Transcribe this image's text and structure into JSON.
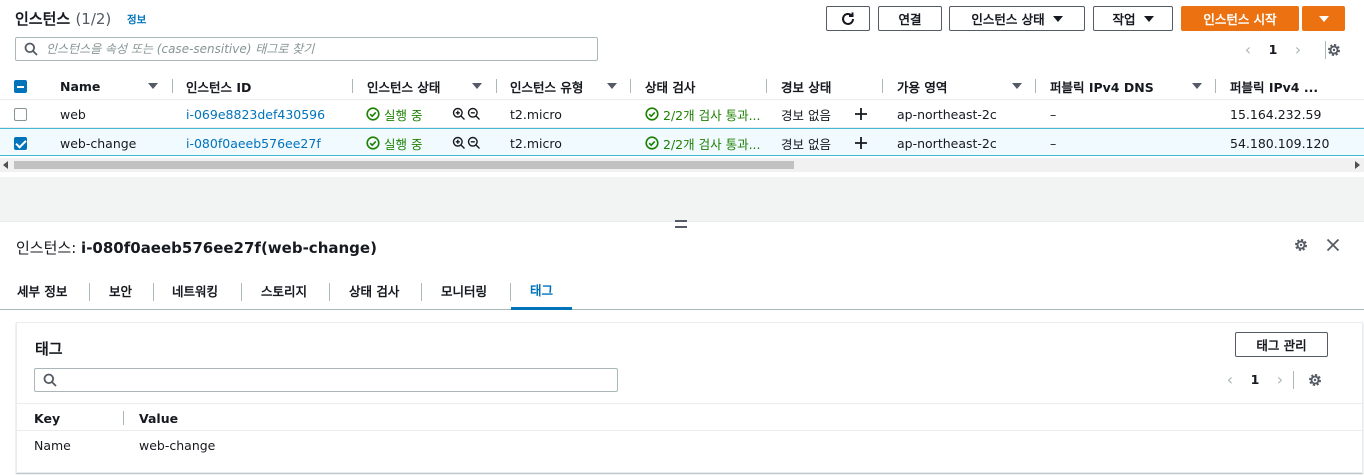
{
  "header": {
    "title": "인스턴스",
    "count": "(1/2)",
    "info_link": "정보"
  },
  "toolbar": {
    "connect": "연결",
    "instance_state": "인스턴스 상태",
    "actions": "작업",
    "launch": "인스턴스 시작"
  },
  "search": {
    "placeholder": "인스턴스을 속성 또는 (case-sensitive) 태그로 찾기"
  },
  "pagination": {
    "page": "1"
  },
  "table": {
    "columns": [
      "Name",
      "인스턴스 ID",
      "인스턴스 상태",
      "인스턴스 유형",
      "상태 검사",
      "경보 상태",
      "가용 영역",
      "퍼블릭 IPv4 DNS",
      "퍼블릭 IPv4 ..."
    ],
    "rows": [
      {
        "name": "web",
        "id": "i-069e8823def430596",
        "state": "실행 중",
        "type": "t2.micro",
        "check": "2/2개 검사 통과...",
        "alarm": "경보 없음",
        "az": "ap-northeast-2c",
        "dns": "–",
        "ip": "15.164.232.59",
        "selected": false
      },
      {
        "name": "web-change",
        "id": "i-080f0aeeb576ee27f",
        "state": "실행 중",
        "type": "t2.micro",
        "check": "2/2개 검사 통과...",
        "alarm": "경보 없음",
        "az": "ap-northeast-2c",
        "dns": "–",
        "ip": "54.180.109.120",
        "selected": true
      }
    ]
  },
  "detail": {
    "title_prefix": "인스턴스:",
    "title_value": "i-080f0aeeb576ee27f(web-change)",
    "tabs": [
      "세부 정보",
      "보안",
      "네트워킹",
      "스토리지",
      "상태 검사",
      "모니터링",
      "태그"
    ],
    "active_tab": "태그",
    "tags": {
      "title": "태그",
      "manage_button": "태그 관리",
      "page": "1",
      "columns": [
        "Key",
        "Value"
      ],
      "rows": [
        {
          "key": "Name",
          "value": "web-change"
        }
      ]
    }
  },
  "colors": {
    "primary": "#ec7211",
    "link": "#0073bb",
    "success": "#1d8102",
    "selected_row": "#f1faff"
  }
}
